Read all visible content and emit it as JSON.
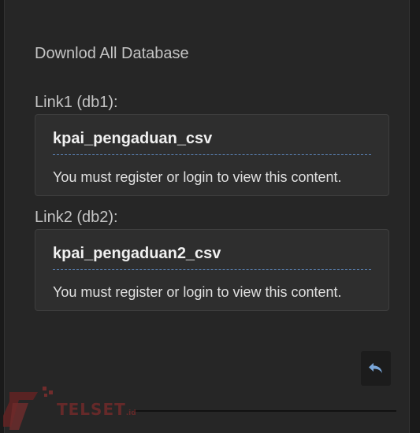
{
  "post": {
    "heading": "Downlod All Database",
    "links": [
      {
        "label": "Link1 (db1):",
        "title": "kpai_pengaduan_csv",
        "message": "You must register or login to view this content."
      },
      {
        "label": "Link2 (db2):",
        "title": "kpai_pengaduan2_csv",
        "message": "You must register or login to view this content."
      }
    ],
    "reply_icon": "reply-arrow-icon"
  },
  "watermark": {
    "brand": "TELSET",
    "tld": ".id",
    "colors": {
      "brand": "#7a2a2a"
    }
  },
  "colors": {
    "background": "#1a1a1a",
    "panel": "#262626",
    "spoiler_bg": "#2e2e2e",
    "rule": "#5b84b8",
    "reply_icon": "#7aa6d8"
  }
}
